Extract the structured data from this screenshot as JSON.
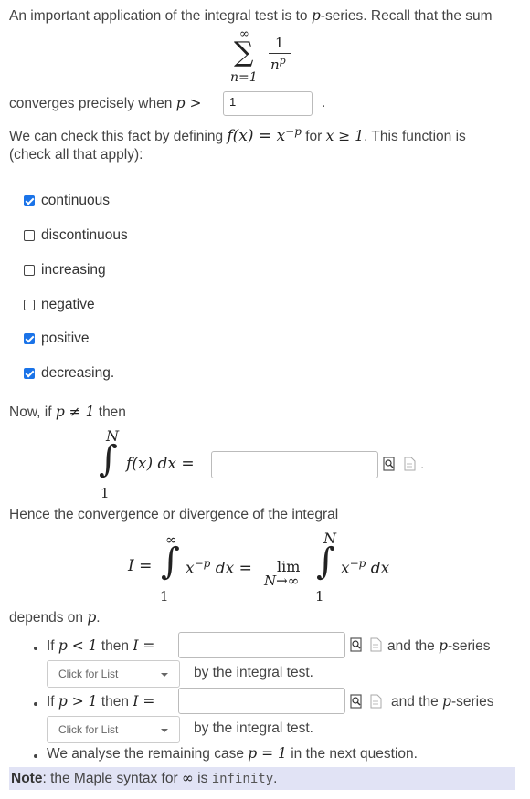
{
  "intro": {
    "line1": "An important application of the integral test is to ",
    "p": "p",
    "line1_end": "-series. Recall that the sum",
    "sum_upper": "∞",
    "sum_lower": "n=1",
    "sum_num": "1",
    "sum_den": "n",
    "sum_den_exp": "p"
  },
  "converges": {
    "text": "converges precisely when ",
    "math": "p >",
    "input_value": "1",
    "period": "."
  },
  "define": {
    "line1a": "We can check this fact by defining ",
    "fx": "f(x) = x",
    "fx_exp": "−p",
    "line1b": " for ",
    "cond": "x ≥ 1",
    "line1c": ". This function is",
    "line2": "(check all that apply):"
  },
  "options": [
    {
      "label": "continuous",
      "checked": true
    },
    {
      "label": "discontinuous",
      "checked": false
    },
    {
      "label": "increasing",
      "checked": false
    },
    {
      "label": "negative",
      "checked": false
    },
    {
      "label": "positive",
      "checked": true
    },
    {
      "label": "decreasing.",
      "checked": true
    }
  ],
  "now": {
    "text": "Now, if ",
    "math": "p ≠ 1",
    "text2": " then",
    "int_upper": "N",
    "int_lower": "1",
    "integrand": "f(x) dx =",
    "input_value": "",
    "period": "."
  },
  "hence": {
    "text": "Hence the convergence or divergence of the integral",
    "lhs": "I =",
    "int_upper": "∞",
    "int_lower": "1",
    "integrand1": "x",
    "integrand1_exp": "−p",
    "dx1": " dx =",
    "lim": "lim",
    "lim_sub": "N→∞",
    "int2_upper": "N",
    "int2_lower": "1",
    "integrand2": "x",
    "integrand2_exp": "−p",
    "dx2": " dx"
  },
  "depends": {
    "text": "depends on ",
    "p": "p",
    "period": "."
  },
  "cases": [
    {
      "if": "If ",
      "cond": "p < 1",
      "then": " then ",
      "I": "I =",
      "input_value": "",
      "after": "and the ",
      "p": "p",
      "series": "-series",
      "select": "Click for List",
      "tail": "by the integral test."
    },
    {
      "if": "If ",
      "cond": "p > 1",
      "then": " then ",
      "I": "I =",
      "input_value": "",
      "after": "and the ",
      "p": "p",
      "series": "-series",
      "select": "Click for List",
      "tail": "by the integral test."
    }
  ],
  "last_case": {
    "text": "We analyse the remaining case ",
    "math": "p = 1",
    "text2": " in the next question."
  },
  "note": {
    "bold": "Note",
    "text": ": the Maple syntax for ",
    "inf": "∞",
    "is": " is ",
    "code": "infinity",
    "period": "."
  },
  "colors": {
    "checkbox": "#1a73e8",
    "note_bg": "#e1e3f5"
  },
  "icons": [
    "preview-icon",
    "document-icon"
  ]
}
